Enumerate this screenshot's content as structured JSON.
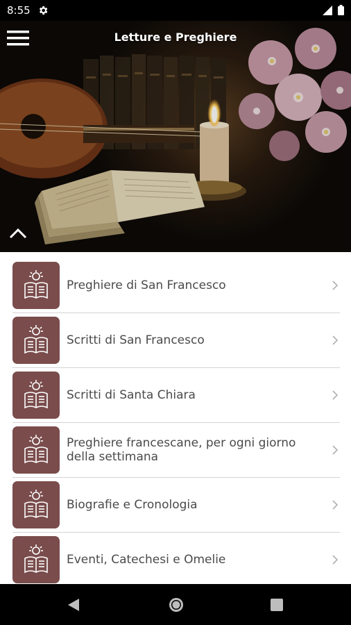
{
  "status": {
    "time": "8:55"
  },
  "header": {
    "title": "Letture e Preghiere"
  },
  "colors": {
    "accent": "#7a4c4c",
    "text": "#4a4a4a",
    "divider": "#d3d3d3"
  },
  "menu": {
    "items": [
      {
        "label": "Preghiere di San Francesco",
        "icon": "open-book-icon"
      },
      {
        "label": "Scritti di San Francesco",
        "icon": "open-book-icon"
      },
      {
        "label": "Scritti di Santa Chiara",
        "icon": "open-book-icon"
      },
      {
        "label": "Preghiere francescane, per ogni giorno della settimana",
        "icon": "open-book-icon"
      },
      {
        "label": "Biografie e Cronologia",
        "icon": "open-book-icon"
      },
      {
        "label": "Eventi, Catechesi e Omelie",
        "icon": "open-book-icon"
      }
    ]
  }
}
